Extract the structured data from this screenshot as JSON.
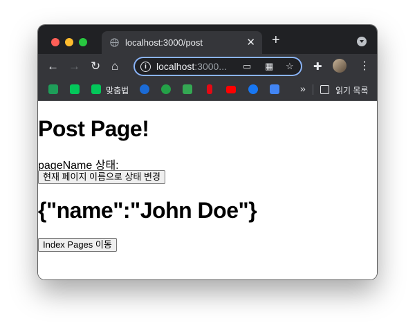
{
  "browser": {
    "tab_title": "localhost:3000/post",
    "url_host": "localhost",
    "url_rest": ":3000...",
    "bookmarks": [
      {
        "label": "",
        "color": "#1e9e59",
        "icon": "d-app-icon"
      },
      {
        "label": "",
        "color": "#03c75a",
        "icon": "naver-icon"
      },
      {
        "label": "맞춤법",
        "color": "#03c75a",
        "icon": "naver-spell-icon"
      },
      {
        "label": "",
        "color": "#1b6bd6",
        "icon": "edge-icon"
      },
      {
        "label": "",
        "color": "#24a148",
        "icon": "globe-icon"
      },
      {
        "label": "",
        "color": "#34a853",
        "icon": "maps-icon"
      },
      {
        "label": "",
        "color": "#e50914",
        "icon": "netflix-icon"
      },
      {
        "label": "",
        "color": "#ff0000",
        "icon": "youtube-icon"
      },
      {
        "label": "",
        "color": "#1877f2",
        "icon": "facebook-icon"
      },
      {
        "label": "",
        "color": "#4285f4",
        "icon": "translate-icon"
      }
    ],
    "overflow": "»",
    "reading_list": "읽기 목록"
  },
  "page": {
    "title": "Post Page!",
    "state_label": "pageName 상태:",
    "change_button": "현재 페이지 이름으로 상태 변경",
    "json_display": "{\"name\":\"John Doe\"}",
    "index_button": "Index Pages 이동"
  }
}
